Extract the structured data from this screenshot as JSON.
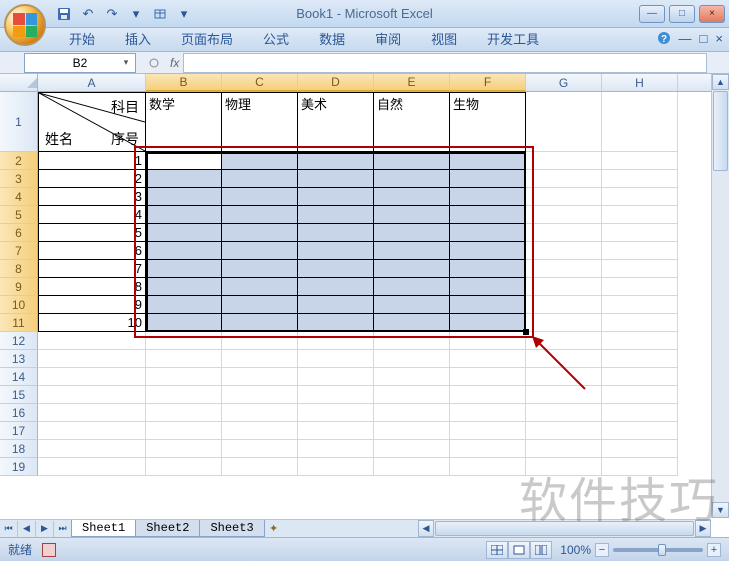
{
  "app": {
    "title": "Book1 - Microsoft Excel"
  },
  "qat": {
    "save": "💾",
    "undo": "↶",
    "redo": "↷",
    "print": "🖨"
  },
  "win": {
    "min": "—",
    "max": "□",
    "close": "×"
  },
  "ribbon": {
    "tabs": [
      "开始",
      "插入",
      "页面布局",
      "公式",
      "数据",
      "审阅",
      "视图",
      "开发工具"
    ],
    "help": "?"
  },
  "namebox": {
    "value": "B2"
  },
  "fx": {
    "label": "fx"
  },
  "columns": [
    "A",
    "B",
    "C",
    "D",
    "E",
    "F",
    "G",
    "H"
  ],
  "rows_visible": 19,
  "a1": {
    "subject": "科目",
    "name": "姓名",
    "seq": "序号"
  },
  "header_subjects": [
    "数学",
    "物理",
    "美术",
    "自然",
    "生物"
  ],
  "seq_numbers": [
    1,
    2,
    3,
    4,
    5,
    6,
    7,
    8,
    9,
    10
  ],
  "sheets": [
    "Sheet1",
    "Sheet2",
    "Sheet3"
  ],
  "status": {
    "ready": "就绪"
  },
  "zoom": {
    "pct": "100%"
  },
  "watermark": "软件技巧",
  "chart_data": {
    "type": "table",
    "title": "",
    "columns": [
      "姓名",
      "序号",
      "数学",
      "物理",
      "美术",
      "自然",
      "生物"
    ],
    "seq": [
      1,
      2,
      3,
      4,
      5,
      6,
      7,
      8,
      9,
      10
    ],
    "selection": "B2:F11"
  }
}
